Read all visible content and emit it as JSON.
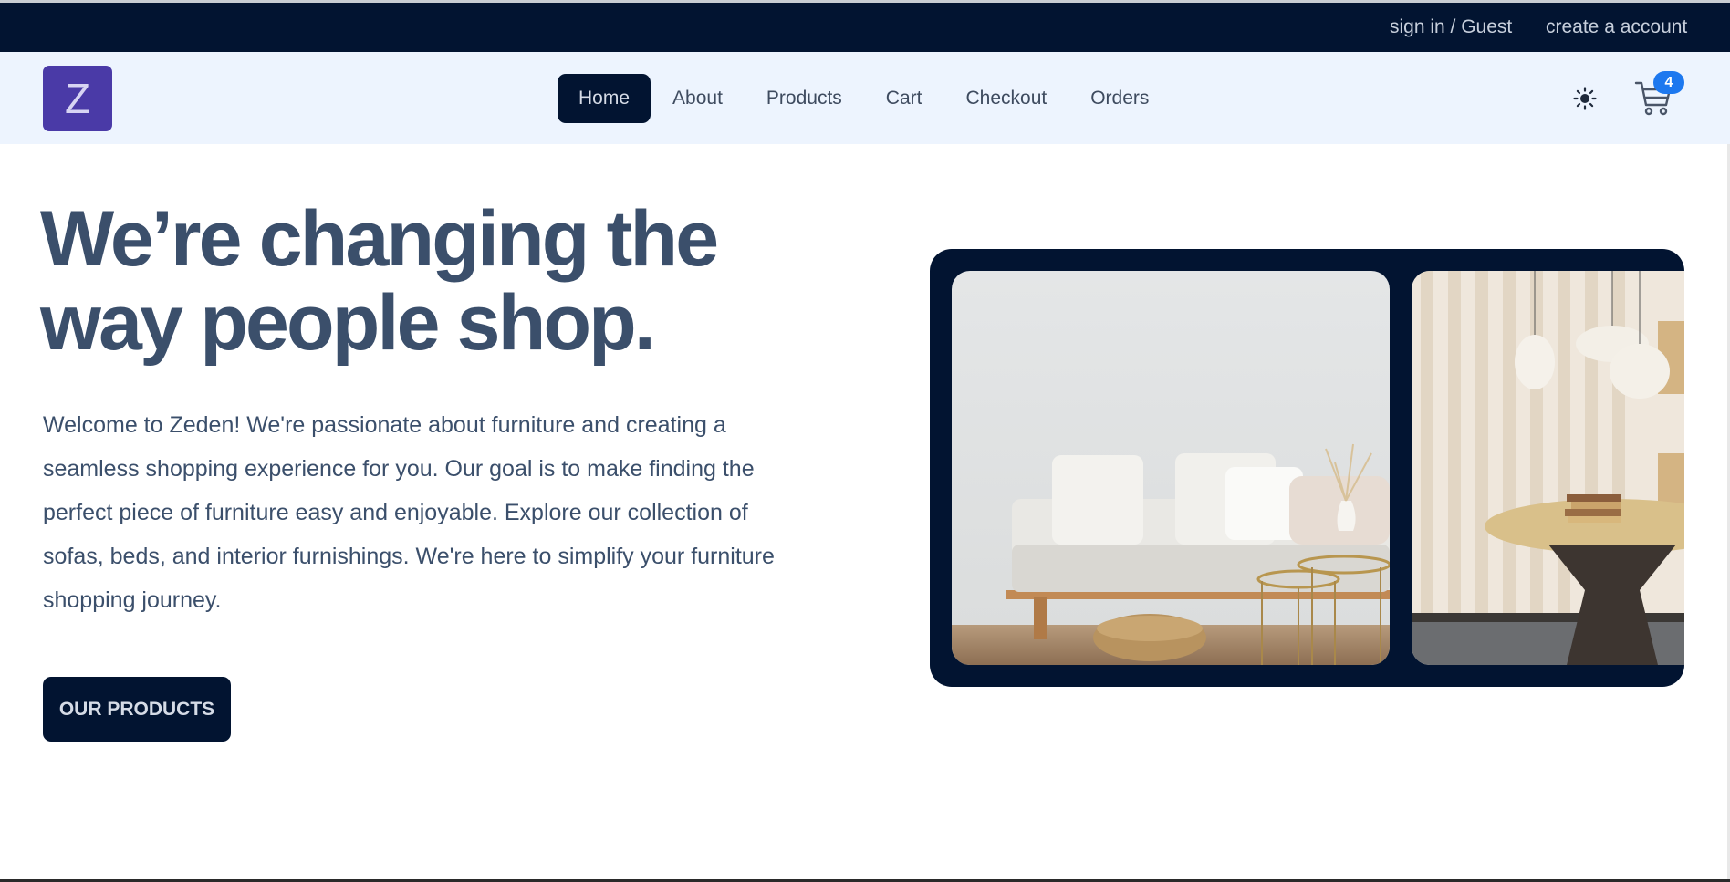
{
  "topbar": {
    "signin_label": "sign in / Guest",
    "create_label": "create a account"
  },
  "brand": {
    "logo_letter": "Z"
  },
  "nav": {
    "items": [
      {
        "label": "Home",
        "active": true
      },
      {
        "label": "About"
      },
      {
        "label": "Products"
      },
      {
        "label": "Cart"
      },
      {
        "label": "Checkout"
      },
      {
        "label": "Orders"
      }
    ]
  },
  "header_icons": {
    "theme_icon": "sun-icon",
    "cart_icon": "cart-icon",
    "cart_count": "4"
  },
  "hero": {
    "title": "We’re changing the way people shop.",
    "description": "Welcome to Zeden! We're passionate about furniture and creating a seamless shopping experience for you. Our goal is to make finding the perfect piece of furniture easy and enjoyable. Explore our collection of sofas, beds, and interior furnishings. We're here to simplify your furniture shopping journey.",
    "cta_label": "OUR PRODUCTS"
  },
  "colors": {
    "navy": "#021431",
    "nav_bg": "#edf4fe",
    "logo_purple": "#4a3aa7",
    "badge_blue": "#1d78ef",
    "text_slate": "#3b4f6b"
  }
}
